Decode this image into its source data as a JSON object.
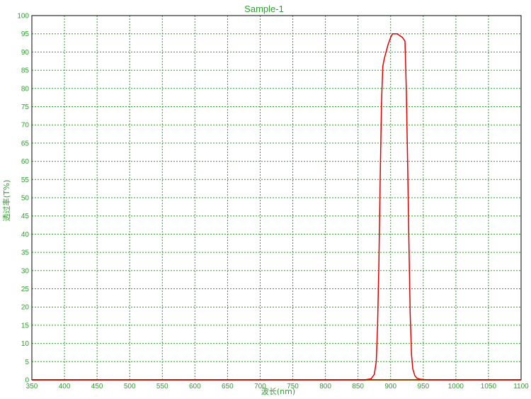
{
  "colors": {
    "axis_text": "#2e9c2e",
    "grid": "#27a327",
    "frame": "#000000",
    "series": "#e00000",
    "axis_baseline": "#a04000"
  },
  "chart_data": {
    "type": "line",
    "title": "Sample-1",
    "xlabel": "波长(nm)",
    "ylabel": "透过率(T%)",
    "xlim": [
      350,
      1100
    ],
    "ylim": [
      0,
      100
    ],
    "xticks": [
      350,
      400,
      450,
      500,
      550,
      600,
      650,
      700,
      750,
      800,
      850,
      900,
      950,
      1000,
      1050,
      1100
    ],
    "yticks": [
      0,
      5,
      10,
      15,
      20,
      25,
      30,
      35,
      40,
      45,
      50,
      55,
      60,
      65,
      70,
      75,
      80,
      85,
      90,
      95,
      100
    ],
    "grid": true,
    "series": [
      {
        "x": [
          350,
          860,
          870,
          875,
          878,
          880,
          882,
          884,
          886,
          888,
          890,
          893,
          896,
          900,
          903,
          906,
          910,
          914,
          918,
          922,
          924,
          926,
          928,
          930,
          932,
          934,
          937,
          940,
          945,
          950,
          960,
          1100
        ],
        "y": [
          0,
          0,
          0.3,
          1.5,
          5,
          15,
          32,
          55,
          76,
          86,
          88,
          90,
          92,
          94,
          95,
          95,
          95,
          94.5,
          94,
          93,
          80,
          60,
          38,
          18,
          7,
          3,
          1.2,
          0.5,
          0.2,
          0.1,
          0,
          0
        ]
      }
    ]
  }
}
